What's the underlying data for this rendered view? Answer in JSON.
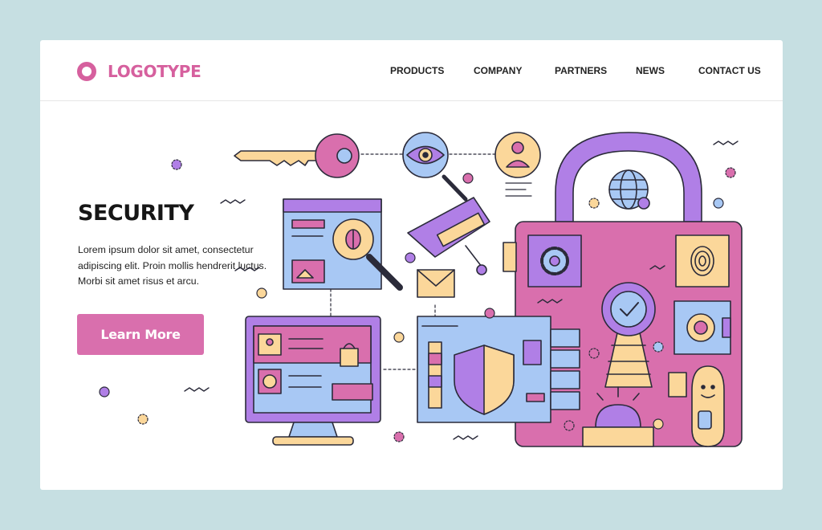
{
  "brand": {
    "name": "LOGOTYPE",
    "color": "#d6609e"
  },
  "nav": {
    "items": [
      "PRODUCTS",
      "COMPANY",
      "PARTNERS",
      "NEWS",
      "CONTACT US"
    ]
  },
  "hero": {
    "title": "SECURITY",
    "lines": [
      "Lorem ipsum dolor sit amet, consectetur",
      "adipiscing elit. Proin mollis hendrerit luctus.",
      "Morbi sit amet risus et arcu."
    ],
    "cta_label": "Learn More",
    "cta_color": "#d96fad"
  },
  "colors": {
    "background": "#c6dfe2",
    "purple": "#b07fe6",
    "pink": "#d96fad",
    "blue": "#a8c8f4",
    "peach": "#fbd79a",
    "outline": "#2b2b3a"
  },
  "illustration": {
    "icons": [
      "key-icon",
      "eye-icon",
      "user-icon",
      "padlock-icon",
      "globe-icon",
      "browser-window-icon",
      "bug-magnifier-icon",
      "security-camera-icon",
      "mail-icon",
      "desktop-monitor-icon",
      "shield-icon",
      "server-icon",
      "gear-icon",
      "fingerprint-icon",
      "checkmark-badge-icon",
      "safe-icon",
      "alarm-siren-icon",
      "guard-character-icon"
    ]
  }
}
